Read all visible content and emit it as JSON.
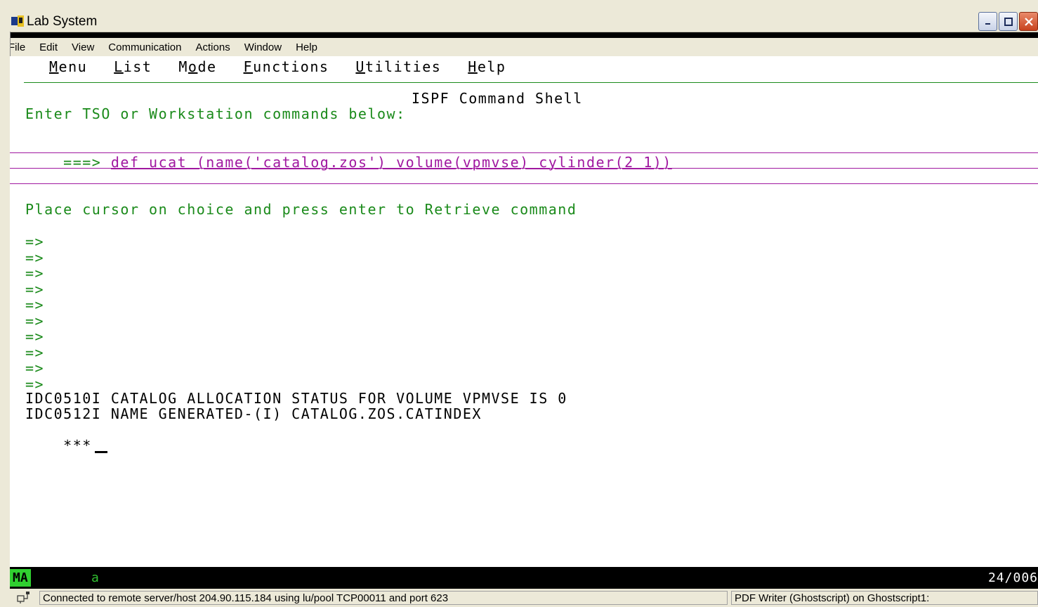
{
  "window": {
    "title": "Lab System",
    "app_icon": "terminal-app-icon",
    "buttons": [
      "minimize-icon",
      "maximize-icon",
      "close-icon"
    ]
  },
  "menubar": {
    "items": [
      "File",
      "Edit",
      "View",
      "Communication",
      "Actions",
      "Window",
      "Help"
    ]
  },
  "ispf": {
    "pulldown": [
      {
        "label": "Menu",
        "hotkey": "M"
      },
      {
        "label": "List",
        "hotkey": "L"
      },
      {
        "label": "Mode",
        "hotkey": "o"
      },
      {
        "label": "Functions",
        "hotkey": "F"
      },
      {
        "label": "Utilities",
        "hotkey": "U"
      },
      {
        "label": "Help",
        "hotkey": "H"
      }
    ],
    "panel_title": "ISPF Command Shell",
    "instruction": "Enter TSO or Workstation commands below:",
    "prompt": "===>",
    "command": "def ucat (name('catalog.zos') volume(vpmvse) cylinder(2 1))",
    "retrieve_hint": "Place cursor on choice and press enter to Retrieve command",
    "retrieve_marker": "=>",
    "retrieve_count": 10,
    "output_lines": [
      "IDC0510I CATALOG ALLOCATION STATUS FOR VOLUME VPMVSE IS 0",
      "IDC0512I NAME GENERATED-(I) CATALOG.ZOS.CATINDEX"
    ],
    "more_marker": "***"
  },
  "oia": {
    "mode": "MA",
    "field": "a",
    "cursor_pos": "24/006"
  },
  "statusbar": {
    "connection": "Connected to remote server/host 204.90.115.184 using lu/pool TCP00011 and port 623",
    "printer": "PDF Writer (Ghostscript) on Ghostscript1:"
  },
  "colors": {
    "terminal_bg": "#ffffff",
    "green_text": "#1a8a1a",
    "magenta_input": "#a018a0",
    "oia_green": "#30d030"
  }
}
